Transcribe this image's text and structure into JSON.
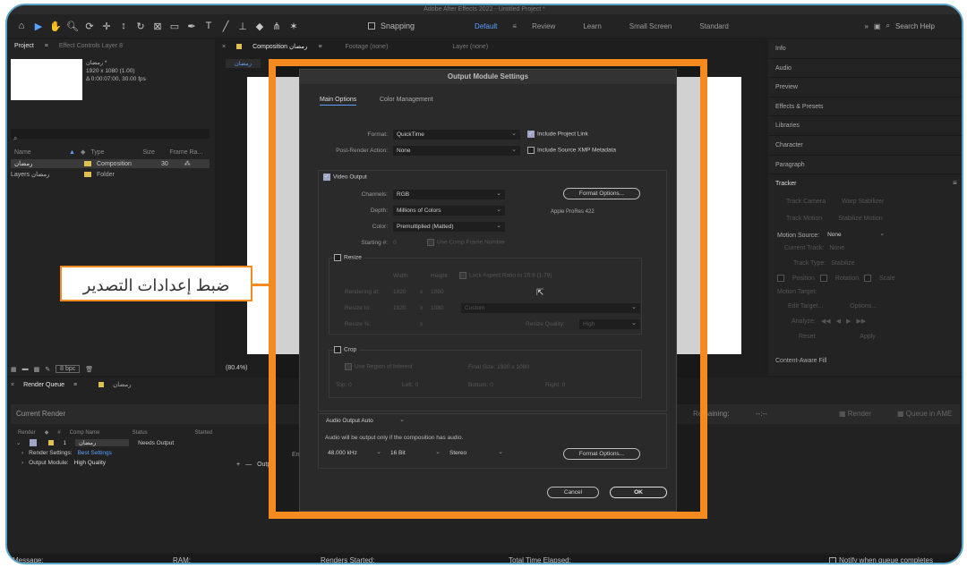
{
  "app": {
    "title": "Adobe After Effects 2022 - Untitled Project *"
  },
  "toolbar": {
    "snapping_label": "Snapping",
    "workspaces": [
      "Default",
      "Review",
      "Learn",
      "Small Screen",
      "Standard"
    ],
    "active_workspace": "Default",
    "search_label": "Search Help"
  },
  "project_panel": {
    "tab_project": "Project",
    "tab_effect_controls": "Effect Controls Layer 8",
    "item_name": "رمضان *",
    "item_info1": "1920 x 1080 (1.00)",
    "item_info2": "Δ 0:00:07:00, 30.00 fps",
    "col_name": "Name",
    "col_type": "Type",
    "col_size": "Size",
    "col_frame_rate": "Frame Ra...",
    "rows": [
      {
        "name": "رمضان",
        "type": "Composition",
        "frame_rate": "30"
      },
      {
        "name": "Layers رمضان",
        "type": "Folder",
        "frame_rate": ""
      }
    ],
    "bpc": "8 bpc"
  },
  "composition_panel": {
    "tab_label": "Composition رمضان",
    "tab_footage": "Footage (none)",
    "tab_layer": "Layer (none)",
    "subtab": "رمضان",
    "zoom": "(80.4%)"
  },
  "right_panel": {
    "items": [
      "Info",
      "Audio",
      "Preview",
      "Effects & Presets",
      "Libraries",
      "Character",
      "Paragraph",
      "Tracker"
    ],
    "tracker_buttons": [
      "Track Camera",
      "Warp Stabilizer",
      "Track Motion",
      "Stabilize Motion"
    ],
    "motion_source_label": "Motion Source:",
    "motion_source_value": "None",
    "current_track_label": "Current Track:",
    "current_track_value": "None",
    "track_type_label": "Track Type:",
    "track_type_value": "Stabilize",
    "checks": [
      "Position",
      "Rotation",
      "Scale"
    ],
    "motion_target": "Motion Target:",
    "edit_target": "Edit Target...",
    "options": "Options...",
    "analyze": "Analyze:",
    "reset": "Reset",
    "apply": "Apply",
    "content_aware": "Content-Aware Fill"
  },
  "render_queue": {
    "tab_label": "Render Queue",
    "tab_comp": "رمضان",
    "current_render": "Current Render",
    "remaining_label": "Remaining:",
    "remaining_value": "--:--",
    "render_button": "Render",
    "queue_ame": "Queue in AME",
    "cols": [
      "Render",
      "#",
      "Comp Name",
      "Status",
      "Started"
    ],
    "row_number": "1",
    "row_comp": "رمضان",
    "row_status": "Needs Output",
    "render_settings_label": "Render Settings:",
    "render_settings_value": "Best Settings",
    "output_module_label": "Output Module:",
    "output_module_value": "High Quality",
    "output_to_partial": "Outp",
    "err_partial": "Err"
  },
  "status_bar": {
    "message": "Message:",
    "ram": "RAM:",
    "renders_started": "Renders Started:",
    "total_time": "Total Time Elapsed:",
    "notify": "Notify when queue completes"
  },
  "dialog": {
    "title": "Output Module Settings",
    "tab_main": "Main Options",
    "tab_color": "Color Management",
    "format_label": "Format:",
    "format_value": "QuickTime",
    "include_project_link": "Include Project Link",
    "post_render_label": "Post-Render Action:",
    "post_render_value": "None",
    "include_xmp": "Include Source XMP Metadata",
    "video_output": "Video Output",
    "channels_label": "Channels:",
    "channels_value": "RGB",
    "format_options": "Format Options...",
    "depth_label": "Depth:",
    "depth_value": "Millions of Colors",
    "codec_note": "Apple ProRes 422",
    "color_label": "Color:",
    "color_value": "Premultiplied (Matted)",
    "starting_label": "Starting #:",
    "starting_value": "0",
    "use_comp_frame": "Use Comp Frame Number",
    "resize": "Resize",
    "width_label": "Width",
    "height_label": "Height",
    "lock_aspect": "Lock Aspect Ratio to 16:9 (1.78)",
    "rendering_at": "Rendering at:",
    "rendering_w": "1920",
    "rendering_h": "1080",
    "resize_to": "Resize to:",
    "resize_w": "1920",
    "resize_h": "1080",
    "resize_preset": "Custom",
    "resize_pct": "Resize %:",
    "resize_quality_label": "Resize Quality:",
    "resize_quality_value": "High",
    "crop": "Crop",
    "use_roi": "Use Region of Interest",
    "final_size": "Final Size: 1920 x 1080",
    "top": "Top:",
    "top_v": "0",
    "left": "Left:",
    "left_v": "0",
    "bottom": "Bottom:",
    "bottom_v": "0",
    "right": "Right:",
    "right_v": "0",
    "audio_output": "Audio Output Auto",
    "audio_note": "Audio will be output only if the composition has audio.",
    "sample_rate": "48.000 kHz",
    "bit_depth": "16 Bit",
    "channels_audio": "Stereo",
    "audio_format_options": "Format Options...",
    "cancel": "Cancel",
    "ok": "OK"
  },
  "callout": {
    "text": "ضبط إعدادات التصدير"
  },
  "colors": {
    "accent_orange": "#f58a1f",
    "accent_blue": "#5aa0ff",
    "frame_border": "#5aa5c8"
  }
}
